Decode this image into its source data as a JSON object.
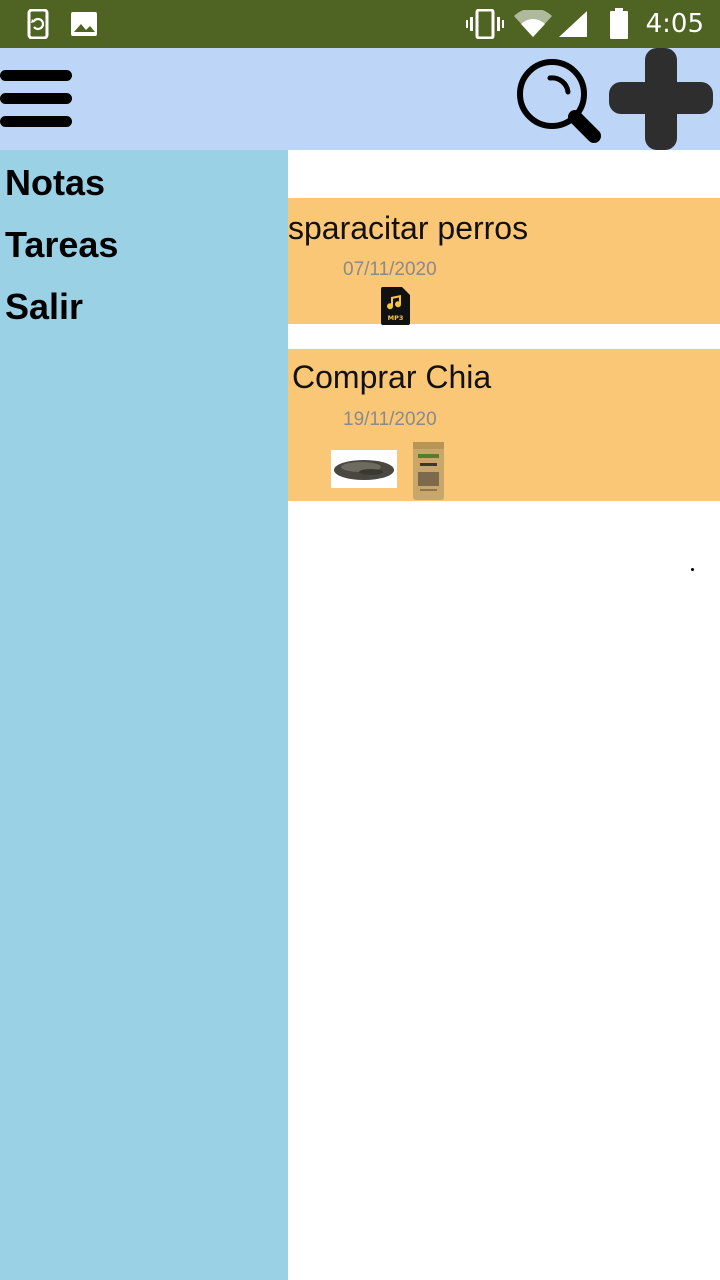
{
  "status_bar": {
    "time": "4:05",
    "icons": [
      "screen-rotate-icon",
      "image-icon",
      "vibrate-icon",
      "wifi-icon",
      "signal-icon",
      "battery-icon"
    ],
    "background": "#4f6422"
  },
  "app_bar": {
    "background": "#bdd6f7",
    "actions": [
      "menu-icon",
      "search-icon",
      "add-icon"
    ]
  },
  "drawer": {
    "background": "#9ad1e5",
    "items": [
      {
        "label": "Notas"
      },
      {
        "label": "Tareas"
      },
      {
        "label": "Salir"
      }
    ]
  },
  "notes": [
    {
      "title": "sparacitar perros",
      "date": "07/11/2020",
      "attachments": [
        "mp3-file-icon"
      ]
    },
    {
      "title": "Comprar Chia",
      "date": "19/11/2020",
      "attachments": [
        "chia-seeds-image",
        "chia-package-image"
      ]
    }
  ],
  "colors": {
    "card": "#f9c776",
    "date_text": "#8a8a8a"
  }
}
